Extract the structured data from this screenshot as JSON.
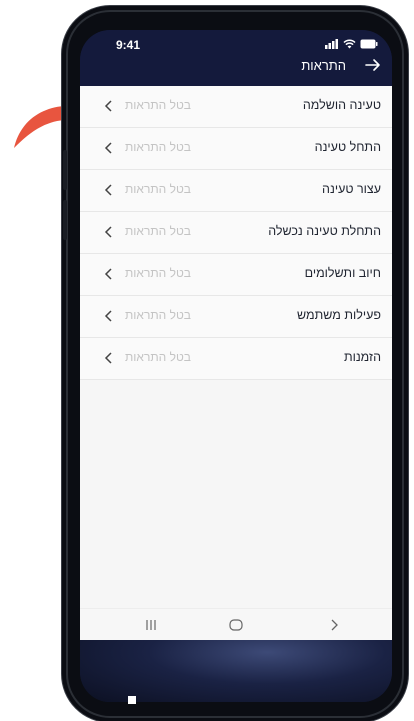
{
  "status_bar": {
    "time": "9:41"
  },
  "header": {
    "title": "התראות"
  },
  "list": {
    "items": [
      {
        "title": "טעינה הושלמה",
        "action": "בטל התראות"
      },
      {
        "title": "התחל טעינה",
        "action": "בטל התראות"
      },
      {
        "title": "עצור טעינה",
        "action": "בטל התראות"
      },
      {
        "title": "התחלת טעינה נכשלה",
        "action": "בטל התראות"
      },
      {
        "title": "חיוב ותשלומים",
        "action": "בטל התראות"
      },
      {
        "title": "פעילות משתמש",
        "action": "בטל התראות"
      },
      {
        "title": "הזמנות",
        "action": "בטל התראות"
      }
    ]
  },
  "nav": {
    "items": [
      "recent-apps-icon",
      "home-icon",
      "back-chevron-icon"
    ]
  },
  "colors": {
    "header_bg": "#141a3c",
    "list_bg": "#fafafa",
    "muted_text": "#c4c4c4",
    "annotation_arrow": "#e8553f"
  }
}
